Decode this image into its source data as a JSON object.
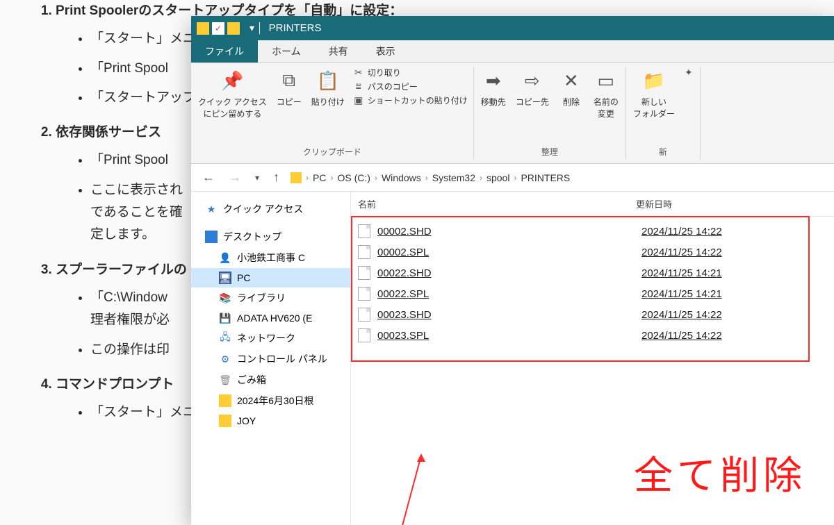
{
  "background_doc": {
    "items": [
      {
        "title_prefix": "Print Spooler",
        "title_suffix": "のスタートアップタイプを「自動」に設定：",
        "bullets": [
          "「スタート」メニュ",
          "「Print Spool",
          "「スタートアップ"
        ]
      },
      {
        "title": "依存関係サービス",
        "bullets": [
          "「Print Spool",
          "ここに表示され\nであることを確\n定します。"
        ]
      },
      {
        "title": "スプーラーファイルの",
        "bullets": [
          "「C:\\Window\n理者権限が必",
          "この操作は印"
        ]
      },
      {
        "title": "コマンドプロンプト",
        "bullets": [
          "「スタート」メニュ"
        ]
      }
    ]
  },
  "explorer": {
    "title": "PRINTERS",
    "tabs": {
      "file": "ファイル",
      "home": "ホーム",
      "share": "共有",
      "view": "表示"
    },
    "ribbon": {
      "pin": "クイック アクセス\nにピン留めする",
      "copy": "コピー",
      "paste": "貼り付け",
      "cut": "切り取り",
      "copypath": "パスのコピー",
      "pasteshortcut": "ショートカットの貼り付け",
      "clipboard_label": "クリップボード",
      "moveto": "移動先",
      "copyto": "コピー先",
      "delete": "削除",
      "rename": "名前の\n変更",
      "organize_label": "整理",
      "newfolder": "新しい\nフォルダー",
      "new_label": "新"
    },
    "breadcrumb": [
      "PC",
      "OS (C:)",
      "Windows",
      "System32",
      "spool",
      "PRINTERS"
    ],
    "sidebar": {
      "quick_access": "クイック アクセス",
      "desktop": "デスクトップ",
      "user": "小池鉄工商事 C",
      "pc": "PC",
      "library": "ライブラリ",
      "drive": "ADATA HV620 (E",
      "network": "ネットワーク",
      "control_panel": "コントロール パネル",
      "recycle": "ごみ箱",
      "folder1": "2024年6月30日根",
      "folder2": "JOY"
    },
    "columns": {
      "name": "名前",
      "date": "更新日時"
    },
    "files": [
      {
        "name": "00002.SHD",
        "date": "2024/11/25 14:22"
      },
      {
        "name": "00002.SPL",
        "date": "2024/11/25 14:22"
      },
      {
        "name": "00022.SHD",
        "date": "2024/11/25 14:21"
      },
      {
        "name": "00022.SPL",
        "date": "2024/11/25 14:21"
      },
      {
        "name": "00023.SHD",
        "date": "2024/11/25 14:22"
      },
      {
        "name": "00023.SPL",
        "date": "2024/11/25 14:22"
      }
    ],
    "annotation": "全て削除"
  }
}
